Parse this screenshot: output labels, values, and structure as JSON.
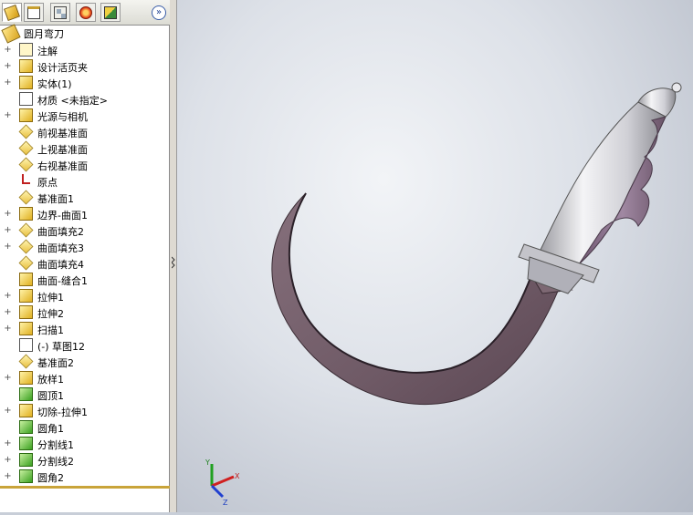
{
  "feature_manager": {
    "tabs": [
      {
        "name": "feature-manager-tab",
        "icon": "feature-tree-icon"
      },
      {
        "name": "property-manager-tab",
        "icon": "property-icon"
      },
      {
        "name": "configuration-manager-tab",
        "icon": "configuration-icon"
      },
      {
        "name": "dimxpert-tab",
        "icon": "dimxpert-icon"
      },
      {
        "name": "display-manager-tab",
        "icon": "display-manager-icon"
      }
    ],
    "expand_symbol": "»",
    "root_label": "圆月弯刀",
    "items": [
      {
        "label": "注解",
        "icon": "annotation-icon",
        "expandable": true
      },
      {
        "label": "设计活页夹",
        "icon": "design-binder-icon",
        "expandable": true
      },
      {
        "label": "实体(1)",
        "icon": "solid-bodies-icon",
        "expandable": true
      },
      {
        "label": "材质 <未指定>",
        "icon": "material-icon",
        "expandable": false
      },
      {
        "label": "光源与相机",
        "icon": "lights-cameras-icon",
        "expandable": true
      },
      {
        "label": "前视基准面",
        "icon": "plane-icon",
        "expandable": false
      },
      {
        "label": "上视基准面",
        "icon": "plane-icon",
        "expandable": false
      },
      {
        "label": "右视基准面",
        "icon": "plane-icon",
        "expandable": false
      },
      {
        "label": "原点",
        "icon": "origin-icon",
        "expandable": false
      },
      {
        "label": "基准面1",
        "icon": "plane-outline-icon",
        "expandable": false
      },
      {
        "label": "边界-曲面1",
        "icon": "boundary-surface-icon",
        "expandable": true
      },
      {
        "label": "曲面填充2",
        "icon": "fill-surface-icon",
        "expandable": true
      },
      {
        "label": "曲面填充3",
        "icon": "fill-surface-icon",
        "expandable": true
      },
      {
        "label": "曲面填充4",
        "icon": "fill-surface-icon",
        "expandable": false
      },
      {
        "label": "曲面-缝合1",
        "icon": "knit-surface-icon",
        "expandable": false
      },
      {
        "label": "拉伸1",
        "icon": "extrude-icon",
        "expandable": true
      },
      {
        "label": "拉伸2",
        "icon": "extrude-icon",
        "expandable": true
      },
      {
        "label": "扫描1",
        "icon": "sweep-icon",
        "expandable": true
      },
      {
        "label": "(-) 草图12",
        "icon": "sketch-icon",
        "expandable": false
      },
      {
        "label": "基准面2",
        "icon": "plane-icon",
        "expandable": false
      },
      {
        "label": "放样1",
        "icon": "loft-icon",
        "expandable": true
      },
      {
        "label": "圆顶1",
        "icon": "dome-icon",
        "expandable": false
      },
      {
        "label": "切除-拉伸1",
        "icon": "cut-extrude-icon",
        "expandable": true
      },
      {
        "label": "圆角1",
        "icon": "fillet-icon",
        "expandable": false
      },
      {
        "label": "分割线1",
        "icon": "split-line-icon",
        "expandable": true
      },
      {
        "label": "分割线2",
        "icon": "split-line-icon",
        "expandable": true
      },
      {
        "label": "圆角2",
        "icon": "fillet-icon",
        "expandable": true
      }
    ]
  },
  "viewport": {
    "model_name": "scimitar-knife-model",
    "blade_color": "#7a6470",
    "handle_color": "#d8d8dc",
    "grip_color": "#8a7088",
    "triad": {
      "x_label": "X",
      "y_label": "Y",
      "z_label": "Z"
    }
  },
  "colors": {
    "panel_bg": "#ffffff",
    "tab_strip": "#e6e6e0",
    "accent_line": "#c9a43a",
    "triad_x": "#d02020",
    "triad_y": "#20a020",
    "triad_z": "#2040d0"
  }
}
